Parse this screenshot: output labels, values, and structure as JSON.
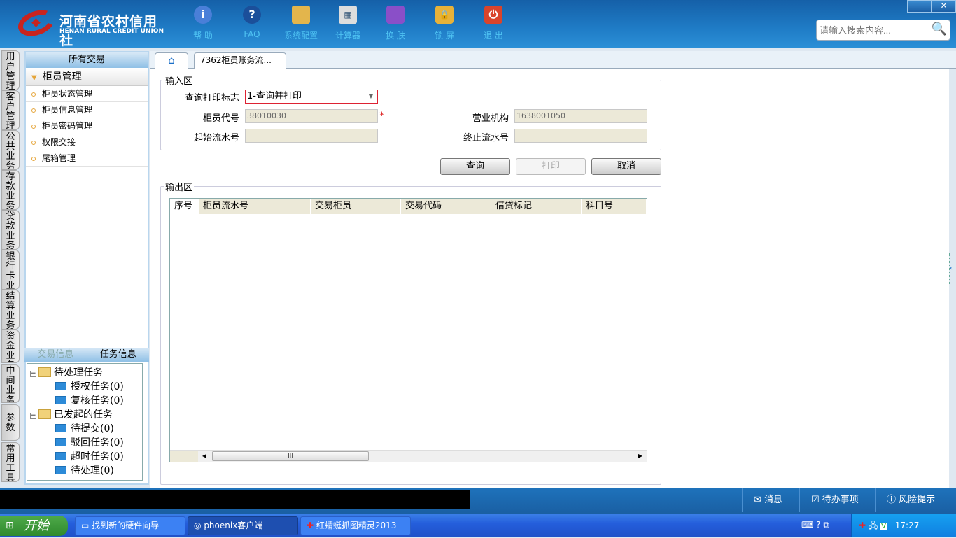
{
  "header": {
    "logo_cn": "河南省农村信用社",
    "logo_en": "HENAN RURAL CREDIT UNION",
    "tools": [
      {
        "label": "帮 助",
        "icon": "info-icon"
      },
      {
        "label": "FAQ",
        "icon": "question-icon"
      },
      {
        "label": "系统配置",
        "icon": "toolbox-icon"
      },
      {
        "label": "计算器",
        "icon": "calculator-icon"
      },
      {
        "label": "换 肤",
        "icon": "shirt-icon"
      },
      {
        "label": "锁 屏",
        "icon": "lock-icon"
      },
      {
        "label": "退 出",
        "icon": "power-icon"
      }
    ],
    "search_placeholder": "请输入搜索内容...",
    "minimize": "–",
    "close": "✕"
  },
  "vtabs": [
    "用户管理",
    "客户管理",
    "公共业务",
    "存款业务",
    "贷款业务",
    "银行卡业务",
    "结算业务",
    "资金业务",
    "中间业务",
    "参数",
    "常用工具"
  ],
  "sidebar": {
    "title": "所有交易",
    "group": "柜员管理",
    "items": [
      "柜员状态管理",
      "柜员信息管理",
      "柜员密码管理",
      "权限交接",
      "尾箱管理"
    ]
  },
  "taskpanel": {
    "tabs": [
      "交易信息",
      "任务信息"
    ],
    "tree": [
      {
        "label": "待处理任务",
        "children": [
          "授权任务(0)",
          "复核任务(0)"
        ]
      },
      {
        "label": "已发起的任务",
        "children": [
          "待提交(0)",
          "驳回任务(0)",
          "超时任务(0)",
          "待处理(0)"
        ]
      }
    ]
  },
  "tabs": {
    "active": "7362柜员账务流...",
    "close": "×"
  },
  "input_area": {
    "legend": "输入区",
    "print_flag_label": "查询打印标志",
    "print_flag_value": "1-查询并打印",
    "teller_label": "柜员代号",
    "teller_value": "38010030",
    "required": "*",
    "branch_label": "营业机构",
    "branch_value": "1638001050",
    "start_label": "起始流水号",
    "start_value": "",
    "end_label": "终止流水号",
    "end_value": ""
  },
  "buttons": {
    "query": "查询",
    "print": "打印",
    "cancel": "取消"
  },
  "output_area": {
    "legend": "输出区",
    "columns": [
      "序号",
      "柜员流水号",
      "交易柜员",
      "交易代码",
      "借贷标记",
      "科目号"
    ],
    "rows": []
  },
  "statusbar": {
    "message": "消息",
    "todo": "待办事项",
    "risk": "风险提示"
  },
  "taskbar": {
    "start": "开始",
    "items": [
      "找到新的硬件向导",
      "phoenix客户端",
      "红蜻蜓抓图精灵2013"
    ],
    "clock": "17:27"
  }
}
